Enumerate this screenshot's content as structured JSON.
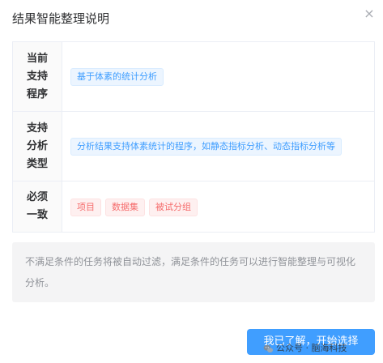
{
  "dialog": {
    "title": "结果智能整理说明",
    "close_symbol": "×"
  },
  "table": {
    "rows": [
      {
        "label": "当前\n支持\n程序",
        "tags": [
          {
            "text": "基于体素的统计分析",
            "color": "blue"
          }
        ]
      },
      {
        "label": "支持\n分析\n类型",
        "tags": [
          {
            "text": "分析结果支持体素统计的程序，如静态指标分析、动态指标分析等",
            "color": "blue"
          }
        ]
      },
      {
        "label": "必须\n一致",
        "tags": [
          {
            "text": "项目",
            "color": "red"
          },
          {
            "text": "数据集",
            "color": "red"
          },
          {
            "text": "被试分组",
            "color": "red"
          }
        ]
      }
    ]
  },
  "notice": "不满足条件的任务将被自动过滤，满足条件的任务可以进行智能整理与可视化分析。",
  "footer": {
    "primary_label": "我已了解，开始选择"
  },
  "watermark": {
    "text": "公众号 · 脑海科技",
    "icon": "wechat-icon"
  },
  "colors": {
    "primary": "#409eff",
    "tag_blue_bg": "#ecf5ff",
    "tag_red_bg": "#fef0f0",
    "notice_bg": "#f4f4f5"
  }
}
